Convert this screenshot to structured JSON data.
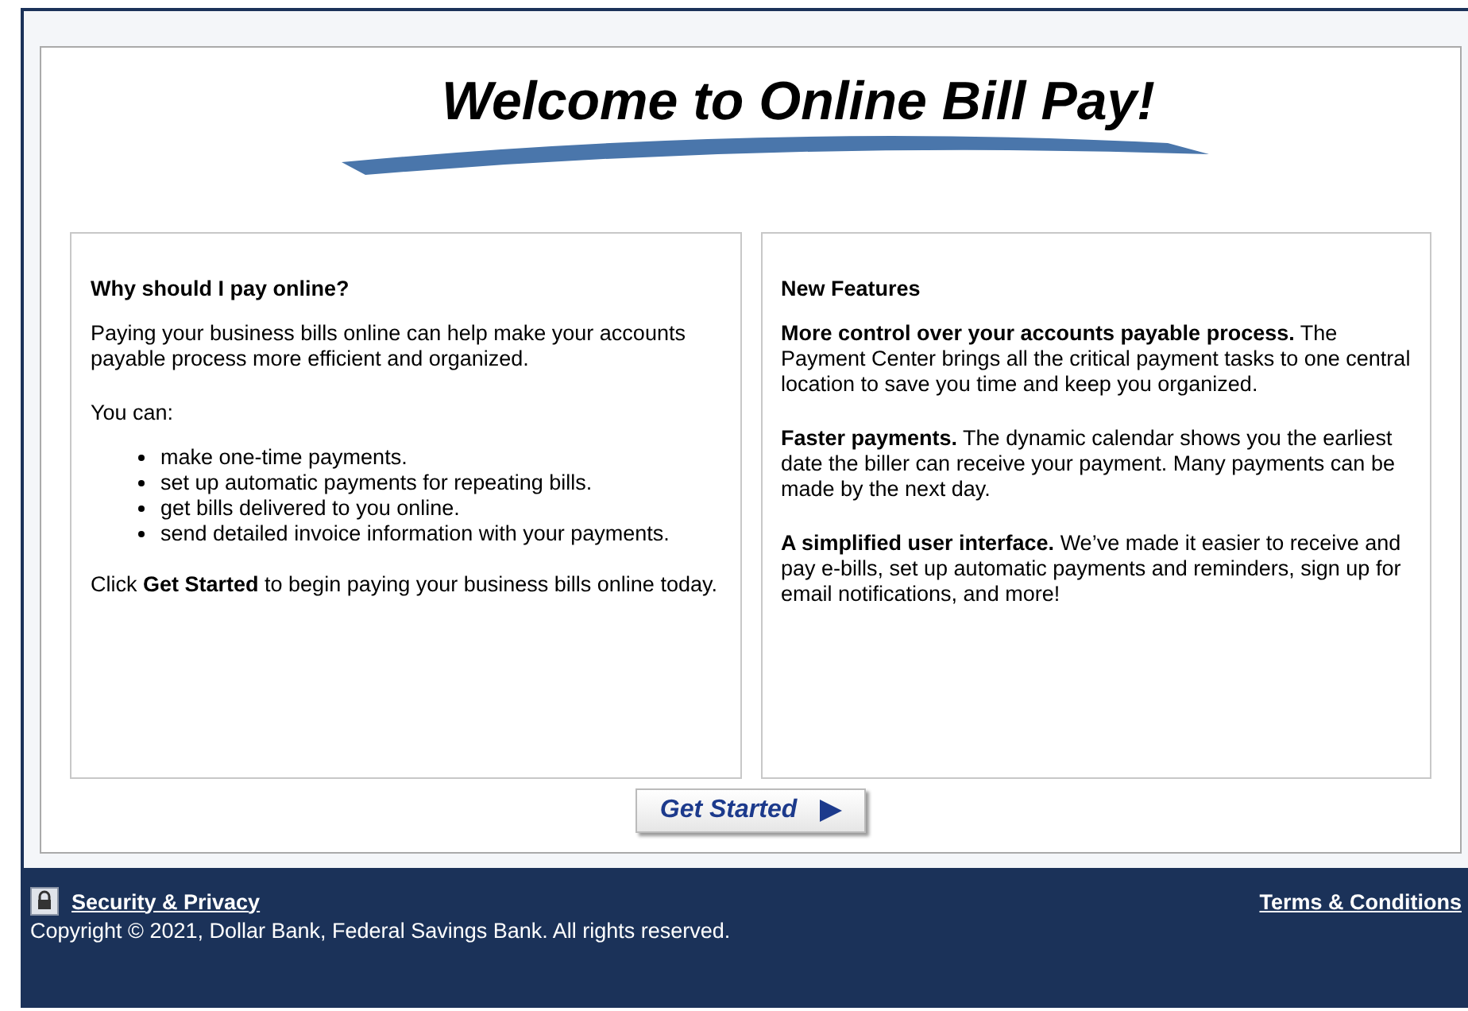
{
  "title": "Welcome to Online Bill Pay!",
  "left_panel": {
    "heading": "Why should I pay online?",
    "intro": "Paying your business bills online can help make your accounts payable process more efficient and organized.",
    "lead_in": "You can:",
    "bullets": [
      "make one-time payments.",
      "set up automatic payments for repeating bills.",
      "get bills delivered to you online.",
      "send detailed invoice information with your payments."
    ],
    "closing": "Click **Get Started** to begin paying your business bills online today."
  },
  "right_panel": {
    "heading": "New Features",
    "paragraphs": [
      "**More control over your accounts payable process.** The Payment Center brings all the critical payment tasks to one central location to save you time and keep you organized.",
      "**Faster payments.** The dynamic calendar shows you the earliest date the biller can receive your payment. Many payments can be made by the next day.",
      "**A simplified user interface.** We’ve made it easier to receive and pay e-bills, set up automatic payments and reminders, sign up for email notifications, and more!"
    ]
  },
  "start_button": {
    "label": "Get Started"
  },
  "footer": {
    "security_link": "Security & Privacy",
    "terms_link": "Terms & Conditions",
    "copyright": "Copyright © 2021, Dollar Bank, Federal Savings Bank. All rights reserved."
  }
}
